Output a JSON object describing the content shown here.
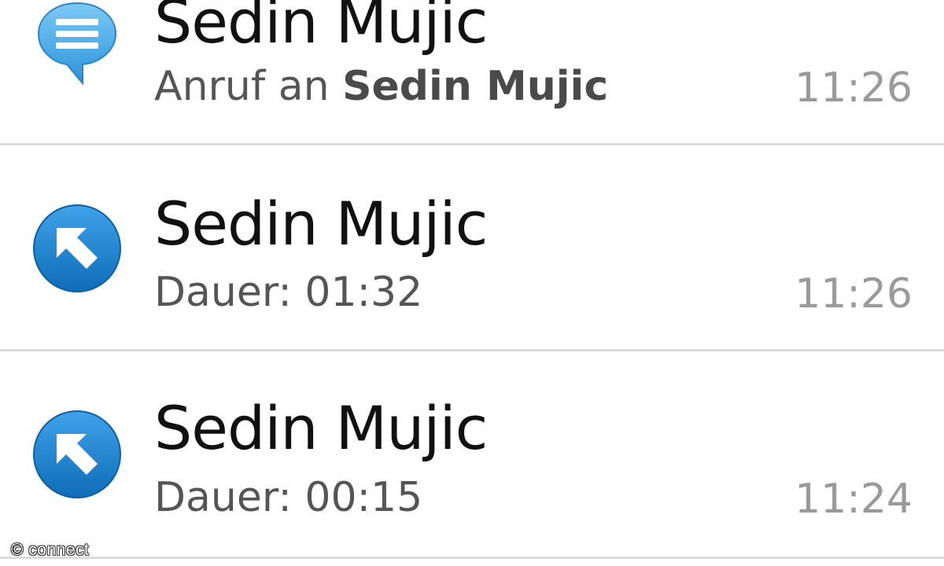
{
  "call_log": {
    "entries": [
      {
        "name": "Sedin Mujic",
        "detail_prefix": "Anruf an ",
        "detail_strong": "Sedin Mujic",
        "time": "11:26",
        "icon": "speech-bubble-icon",
        "icon_color": "#3aa7e6"
      },
      {
        "name": "Sedin Mujic",
        "detail_prefix": "Dauer: 01:32",
        "detail_strong": "",
        "time": "11:26",
        "icon": "outgoing-call-arrow-icon",
        "icon_color": "#1a7fcc"
      },
      {
        "name": "Sedin Mujic",
        "detail_prefix": "Dauer: 00:15",
        "detail_strong": "",
        "time": "11:24",
        "icon": "outgoing-call-arrow-icon",
        "icon_color": "#1a7fcc"
      }
    ]
  },
  "watermark": {
    "text": "© connect"
  },
  "colors": {
    "name_text": "#111111",
    "detail_text": "#555555",
    "time_text": "#9a9a9a",
    "divider": "#dcdcdc"
  }
}
